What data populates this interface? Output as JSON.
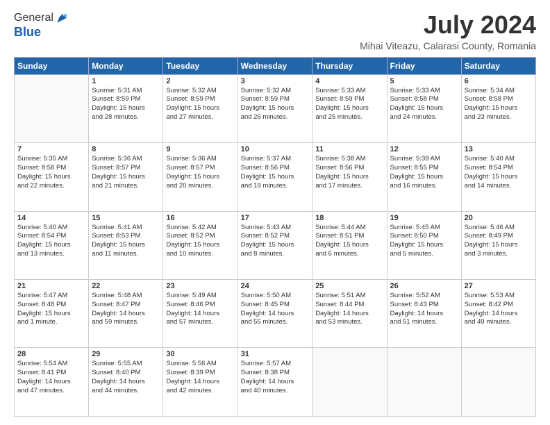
{
  "logo": {
    "general": "General",
    "blue": "Blue"
  },
  "title": "July 2024",
  "location": "Mihai Viteazu, Calarasi County, Romania",
  "days_of_week": [
    "Sunday",
    "Monday",
    "Tuesday",
    "Wednesday",
    "Thursday",
    "Friday",
    "Saturday"
  ],
  "weeks": [
    [
      {
        "day": "",
        "info": ""
      },
      {
        "day": "1",
        "info": "Sunrise: 5:31 AM\nSunset: 8:59 PM\nDaylight: 15 hours\nand 28 minutes."
      },
      {
        "day": "2",
        "info": "Sunrise: 5:32 AM\nSunset: 8:59 PM\nDaylight: 15 hours\nand 27 minutes."
      },
      {
        "day": "3",
        "info": "Sunrise: 5:32 AM\nSunset: 8:59 PM\nDaylight: 15 hours\nand 26 minutes."
      },
      {
        "day": "4",
        "info": "Sunrise: 5:33 AM\nSunset: 8:59 PM\nDaylight: 15 hours\nand 25 minutes."
      },
      {
        "day": "5",
        "info": "Sunrise: 5:33 AM\nSunset: 8:58 PM\nDaylight: 15 hours\nand 24 minutes."
      },
      {
        "day": "6",
        "info": "Sunrise: 5:34 AM\nSunset: 8:58 PM\nDaylight: 15 hours\nand 23 minutes."
      }
    ],
    [
      {
        "day": "7",
        "info": "Sunrise: 5:35 AM\nSunset: 8:58 PM\nDaylight: 15 hours\nand 22 minutes."
      },
      {
        "day": "8",
        "info": "Sunrise: 5:36 AM\nSunset: 8:57 PM\nDaylight: 15 hours\nand 21 minutes."
      },
      {
        "day": "9",
        "info": "Sunrise: 5:36 AM\nSunset: 8:57 PM\nDaylight: 15 hours\nand 20 minutes."
      },
      {
        "day": "10",
        "info": "Sunrise: 5:37 AM\nSunset: 8:56 PM\nDaylight: 15 hours\nand 19 minutes."
      },
      {
        "day": "11",
        "info": "Sunrise: 5:38 AM\nSunset: 8:56 PM\nDaylight: 15 hours\nand 17 minutes."
      },
      {
        "day": "12",
        "info": "Sunrise: 5:39 AM\nSunset: 8:55 PM\nDaylight: 15 hours\nand 16 minutes."
      },
      {
        "day": "13",
        "info": "Sunrise: 5:40 AM\nSunset: 8:54 PM\nDaylight: 15 hours\nand 14 minutes."
      }
    ],
    [
      {
        "day": "14",
        "info": "Sunrise: 5:40 AM\nSunset: 8:54 PM\nDaylight: 15 hours\nand 13 minutes."
      },
      {
        "day": "15",
        "info": "Sunrise: 5:41 AM\nSunset: 8:53 PM\nDaylight: 15 hours\nand 11 minutes."
      },
      {
        "day": "16",
        "info": "Sunrise: 5:42 AM\nSunset: 8:52 PM\nDaylight: 15 hours\nand 10 minutes."
      },
      {
        "day": "17",
        "info": "Sunrise: 5:43 AM\nSunset: 8:52 PM\nDaylight: 15 hours\nand 8 minutes."
      },
      {
        "day": "18",
        "info": "Sunrise: 5:44 AM\nSunset: 8:51 PM\nDaylight: 15 hours\nand 6 minutes."
      },
      {
        "day": "19",
        "info": "Sunrise: 5:45 AM\nSunset: 8:50 PM\nDaylight: 15 hours\nand 5 minutes."
      },
      {
        "day": "20",
        "info": "Sunrise: 5:46 AM\nSunset: 8:49 PM\nDaylight: 15 hours\nand 3 minutes."
      }
    ],
    [
      {
        "day": "21",
        "info": "Sunrise: 5:47 AM\nSunset: 8:48 PM\nDaylight: 15 hours\nand 1 minute."
      },
      {
        "day": "22",
        "info": "Sunrise: 5:48 AM\nSunset: 8:47 PM\nDaylight: 14 hours\nand 59 minutes."
      },
      {
        "day": "23",
        "info": "Sunrise: 5:49 AM\nSunset: 8:46 PM\nDaylight: 14 hours\nand 57 minutes."
      },
      {
        "day": "24",
        "info": "Sunrise: 5:50 AM\nSunset: 8:45 PM\nDaylight: 14 hours\nand 55 minutes."
      },
      {
        "day": "25",
        "info": "Sunrise: 5:51 AM\nSunset: 8:44 PM\nDaylight: 14 hours\nand 53 minutes."
      },
      {
        "day": "26",
        "info": "Sunrise: 5:52 AM\nSunset: 8:43 PM\nDaylight: 14 hours\nand 51 minutes."
      },
      {
        "day": "27",
        "info": "Sunrise: 5:53 AM\nSunset: 8:42 PM\nDaylight: 14 hours\nand 49 minutes."
      }
    ],
    [
      {
        "day": "28",
        "info": "Sunrise: 5:54 AM\nSunset: 8:41 PM\nDaylight: 14 hours\nand 47 minutes."
      },
      {
        "day": "29",
        "info": "Sunrise: 5:55 AM\nSunset: 8:40 PM\nDaylight: 14 hours\nand 44 minutes."
      },
      {
        "day": "30",
        "info": "Sunrise: 5:56 AM\nSunset: 8:39 PM\nDaylight: 14 hours\nand 42 minutes."
      },
      {
        "day": "31",
        "info": "Sunrise: 5:57 AM\nSunset: 8:38 PM\nDaylight: 14 hours\nand 40 minutes."
      },
      {
        "day": "",
        "info": ""
      },
      {
        "day": "",
        "info": ""
      },
      {
        "day": "",
        "info": ""
      }
    ]
  ]
}
